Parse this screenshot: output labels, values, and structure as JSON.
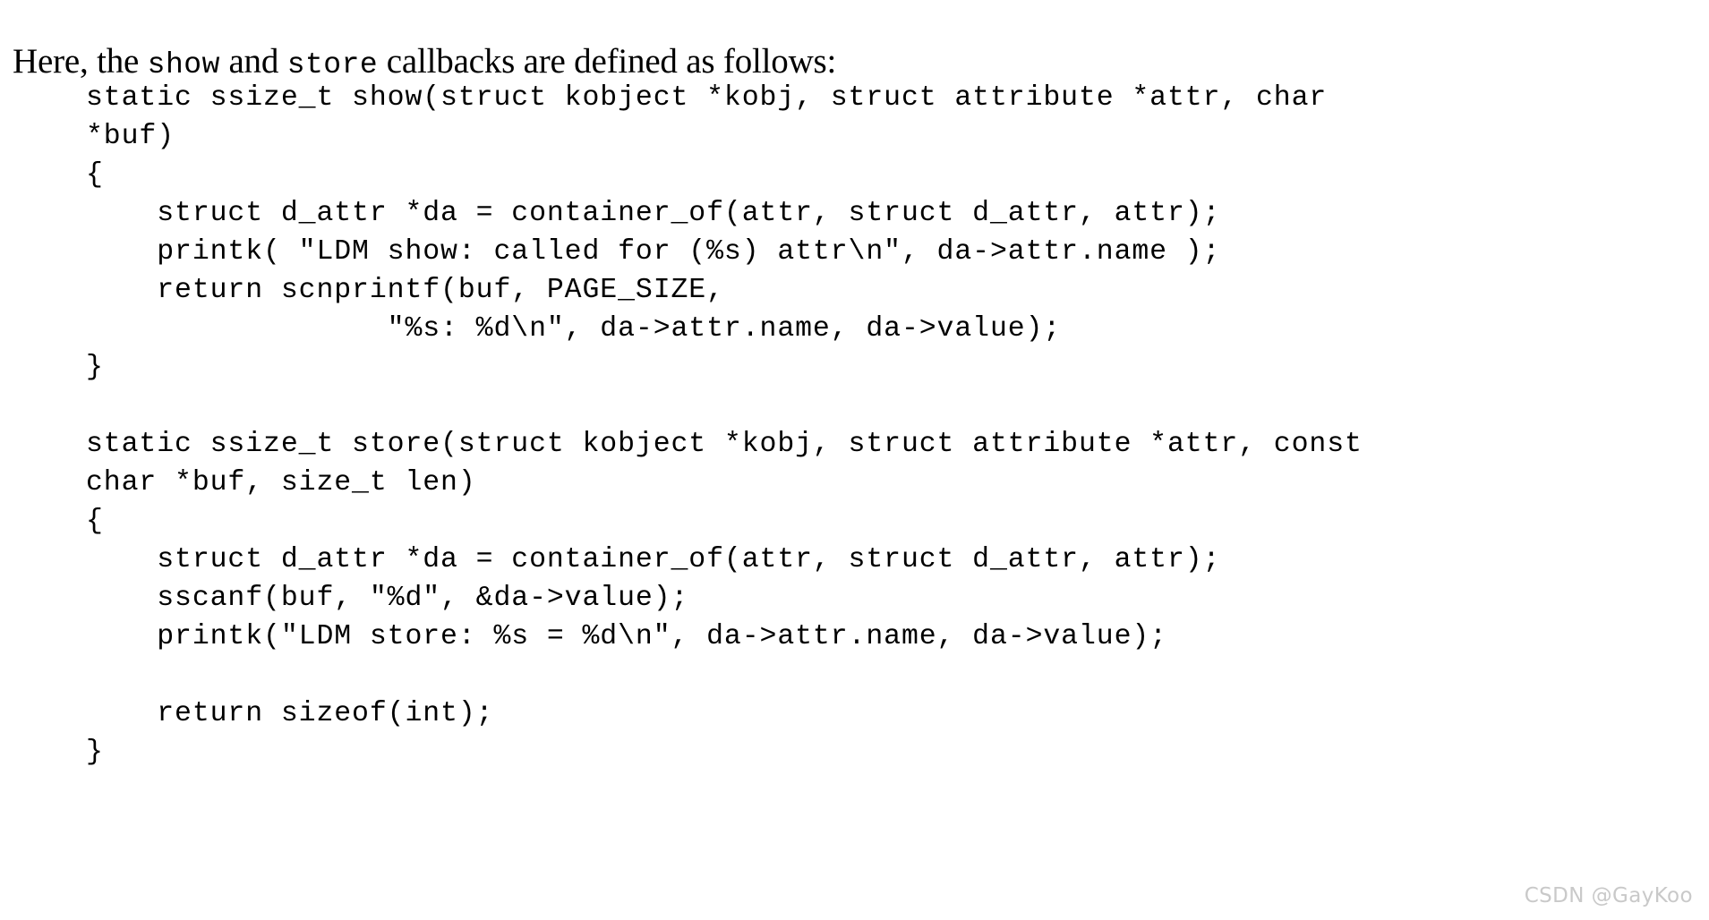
{
  "document": {
    "intro": {
      "part1": "Here, the ",
      "code1": "show",
      "part2": " and ",
      "code2": "store",
      "part3": " callbacks are defined as follows:"
    },
    "code_lines": [
      "static ssize_t show(struct kobject *kobj, struct attribute *attr, char",
      "*buf)",
      "{",
      "    struct d_attr *da = container_of(attr, struct d_attr, attr);",
      "    printk( \"LDM show: called for (%s) attr\\n\", da->attr.name );",
      "    return scnprintf(buf, PAGE_SIZE,",
      "                 \"%s: %d\\n\", da->attr.name, da->value);",
      "}",
      "",
      "static ssize_t store(struct kobject *kobj, struct attribute *attr, const",
      "char *buf, size_t len)",
      "{",
      "    struct d_attr *da = container_of(attr, struct d_attr, attr);",
      "    sscanf(buf, \"%d\", &da->value);",
      "    printk(\"LDM store: %s = %d\\n\", da->attr.name, da->value);",
      "",
      "    return sizeof(int);",
      "}"
    ],
    "watermark": "CSDN @GayKoo",
    "colors": {
      "background": "#ffffff",
      "text": "#000000",
      "watermark": "#c9c9c9"
    }
  }
}
